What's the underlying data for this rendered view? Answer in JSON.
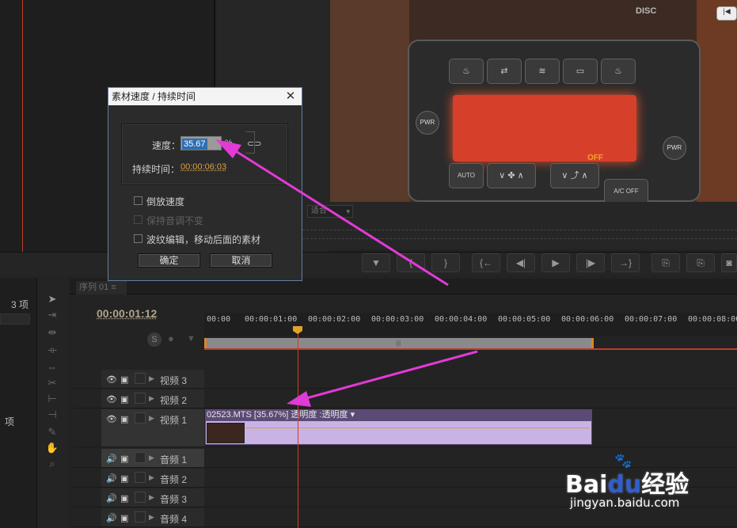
{
  "project_panel": {
    "count_label": "3 项",
    "item_label": "项"
  },
  "program_monitor": {
    "zoom_select": "适合",
    "video": {
      "disc_label": "DISC",
      "screen_text": "OFF",
      "keys": [
        "PWR",
        "PWR",
        "AUTO",
        "A/C OFF"
      ]
    },
    "transport_buttons": [
      "▼",
      "{",
      "}",
      "{←",
      "◀|",
      "▶",
      "|▶",
      "→}",
      "⎘",
      "⎘",
      "◙"
    ]
  },
  "timeline": {
    "tab_label": "序列 01 ≡",
    "timecode": "00:00:01:12",
    "ruler_labels": [
      "00:00",
      "00:00:01:00",
      "00:00:02:00",
      "00:00:03:00",
      "00:00:04:00",
      "00:00:05:00",
      "00:00:06:00",
      "00:00:07:00",
      "00:00:08:00"
    ],
    "video_tracks": [
      "视频 3",
      "视频 2",
      "视频 1"
    ],
    "audio_tracks": [
      "音频 1",
      "音频 2",
      "音频 3",
      "音频 4"
    ],
    "clip_label": "02523.MTS [35.67%]  透明度 :透明度 ▾",
    "playhead_seconds": 1.5
  },
  "dialog": {
    "title": "素材速度 / 持续时间",
    "speed_label": "速度：",
    "speed_value": "35.67",
    "speed_unit": "%",
    "duration_label": "持续时间：",
    "duration_value": "00:00:06:03",
    "reverse_label": "倒放速度",
    "reverse_checked": false,
    "keep_pitch_label": "保持音调不变",
    "keep_pitch_disabled": true,
    "ripple_label": "波纹编辑，移动后面的素材",
    "ripple_checked": false,
    "ok_label": "确定",
    "cancel_label": "取消"
  },
  "watermark": {
    "logo_left": "Bai",
    "logo_mid": "du",
    "logo_right": "经验",
    "url": "jingyan.baidu.com"
  },
  "colors": {
    "arrow": "#e23ad6",
    "clip": "#c9b2e4",
    "playhead": "#d23b2a",
    "accent_time": "#d8a24a"
  }
}
